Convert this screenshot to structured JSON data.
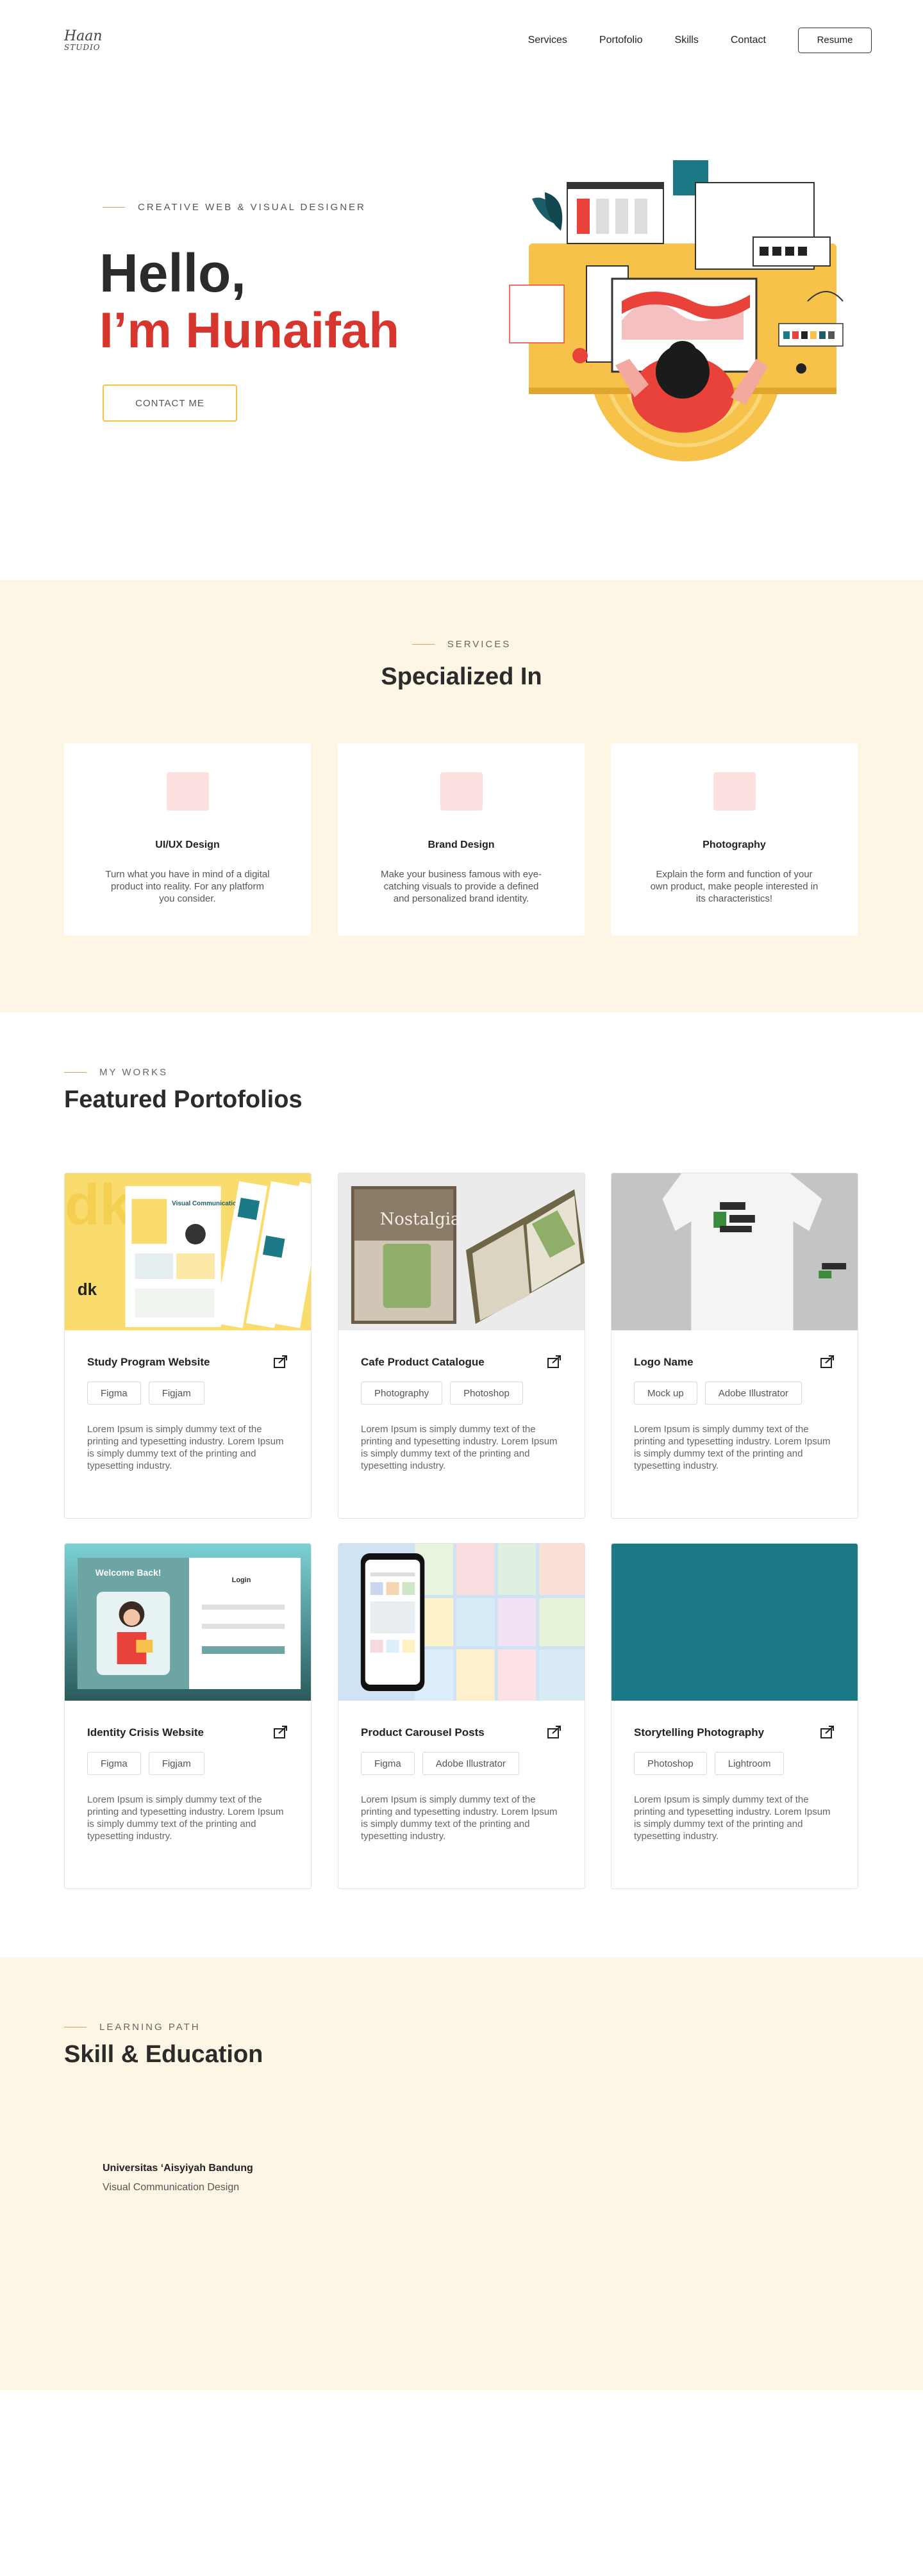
{
  "nav": {
    "logo_top": "Haan",
    "logo_bottom": "STUDIO",
    "links": [
      "Services",
      "Portofolio",
      "Skills",
      "Contact"
    ],
    "resume": "Resume"
  },
  "hero": {
    "eyebrow": "CREATIVE WEB & VISUAL DESIGNER",
    "hello": "Hello,",
    "name": "I’m Hunaifah",
    "cta": "CONTACT ME"
  },
  "services": {
    "eyebrow": "SERVICES",
    "title": "Specialized In",
    "items": [
      {
        "title": "UI/UX Design",
        "desc": "Turn what you have in mind of a digital product into reality. For any platform you consider."
      },
      {
        "title": "Brand Design",
        "desc": "Make your business famous with eye-catching visuals to provide a defined and personalized brand identity."
      },
      {
        "title": "Photography",
        "desc": "Explain the form and function of your own product, make people interested in its characteristics!"
      }
    ]
  },
  "portfolio": {
    "eyebrow": "MY WORKS",
    "title": "Featured Portofolios",
    "items": [
      {
        "name": "Study Program Website",
        "tags": [
          "Figma",
          "Figjam"
        ],
        "desc": "Lorem Ipsum is simply dummy text of the printing and typesetting industry. Lorem Ipsum is simply dummy text of the printing and typesetting industry."
      },
      {
        "name": "Cafe Product Catalogue",
        "tags": [
          "Photography",
          "Photoshop"
        ],
        "desc": "Lorem Ipsum is simply dummy text of the printing and typesetting industry. Lorem Ipsum is simply dummy text of the printing and typesetting industry."
      },
      {
        "name": "Logo Name",
        "tags": [
          "Mock up",
          "Adobe Illustrator"
        ],
        "desc": "Lorem Ipsum is simply dummy text of the printing and typesetting industry. Lorem Ipsum is simply dummy text of the printing and typesetting industry."
      },
      {
        "name": "Identity Crisis Website",
        "tags": [
          "Figma",
          "Figjam"
        ],
        "desc": "Lorem Ipsum is simply dummy text of the printing and typesetting industry. Lorem Ipsum is simply dummy text of the printing and typesetting industry."
      },
      {
        "name": "Product Carousel Posts",
        "tags": [
          "Figma",
          "Adobe Illustrator"
        ],
        "desc": "Lorem Ipsum is simply dummy text of the printing and typesetting industry. Lorem Ipsum is simply dummy text of the printing and typesetting industry."
      },
      {
        "name": "Storytelling Photography",
        "tags": [
          "Photoshop",
          "Lightroom"
        ],
        "desc": "Lorem Ipsum is simply dummy text of the printing and typesetting industry. Lorem Ipsum is simply dummy text of the printing and typesetting industry."
      }
    ],
    "thumb_texts": {
      "study_heading": "Visual Communication Design",
      "cafe_heading": "Nostalgia",
      "login_welcome": "Welcome Back!",
      "login_title": "Login"
    }
  },
  "learning": {
    "eyebrow": "LEARNING PATH",
    "title": "Skill & Education",
    "school": "Universitas ‘Aisyiyah Bandung",
    "major": "Visual Communication Design"
  },
  "colors": {
    "accent_red": "#d6362d",
    "accent_yellow": "#f2c14e",
    "cream": "#fdf6e5",
    "teal": "#1b7a86"
  }
}
